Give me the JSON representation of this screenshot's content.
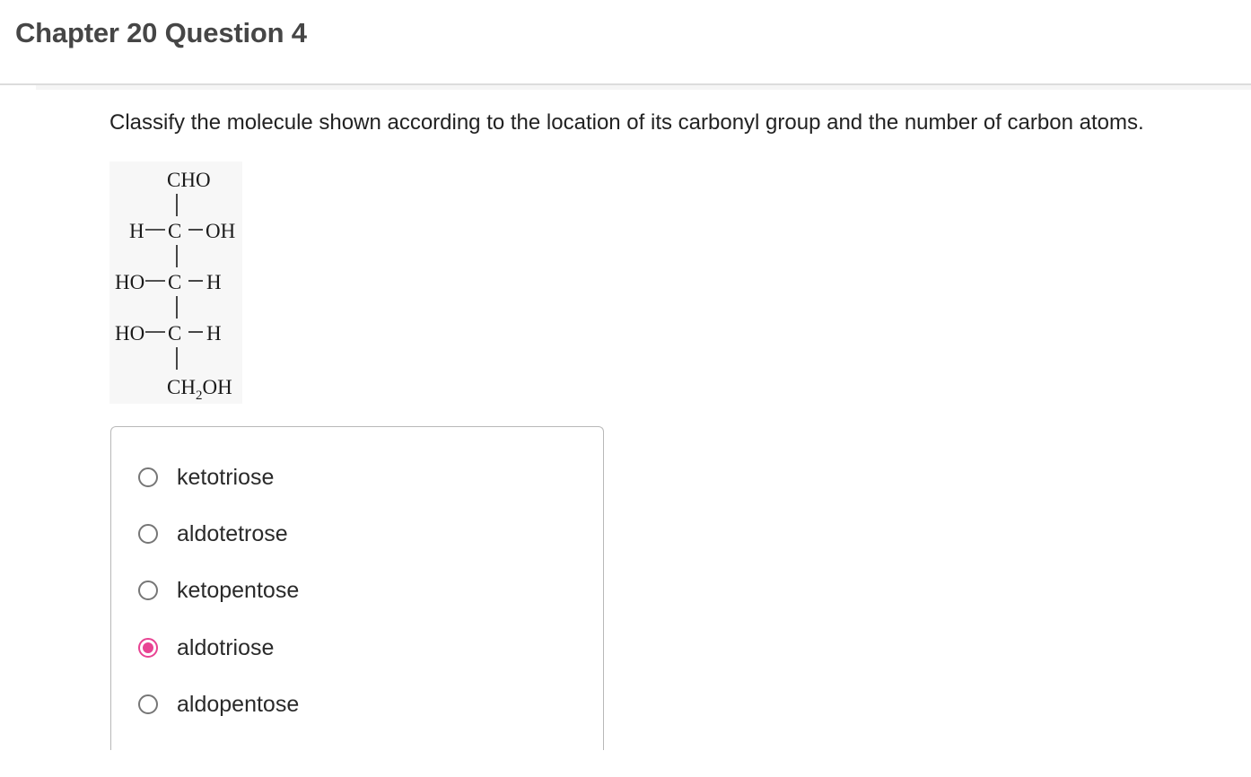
{
  "page": {
    "title": "Chapter 20 Question 4"
  },
  "question": {
    "text": "Classify the molecule shown according to the location of its carbonyl group and the number of carbon atoms."
  },
  "molecule": {
    "top": "CHO",
    "row1_left": "H",
    "row1_center": "C",
    "row1_right": "OH",
    "row2_left": "HO",
    "row2_center": "C",
    "row2_right": "H",
    "row3_left": "HO",
    "row3_center": "C",
    "row3_right": "H",
    "bottom_main": "CH",
    "bottom_sub": "2",
    "bottom_tail": "OH"
  },
  "options": [
    {
      "label": "ketotriose",
      "selected": false
    },
    {
      "label": "aldotetrose",
      "selected": false
    },
    {
      "label": "ketopentose",
      "selected": false
    },
    {
      "label": "aldotriose",
      "selected": true
    },
    {
      "label": "aldopentose",
      "selected": false
    }
  ],
  "colors": {
    "selected_accent": "#e84393"
  }
}
